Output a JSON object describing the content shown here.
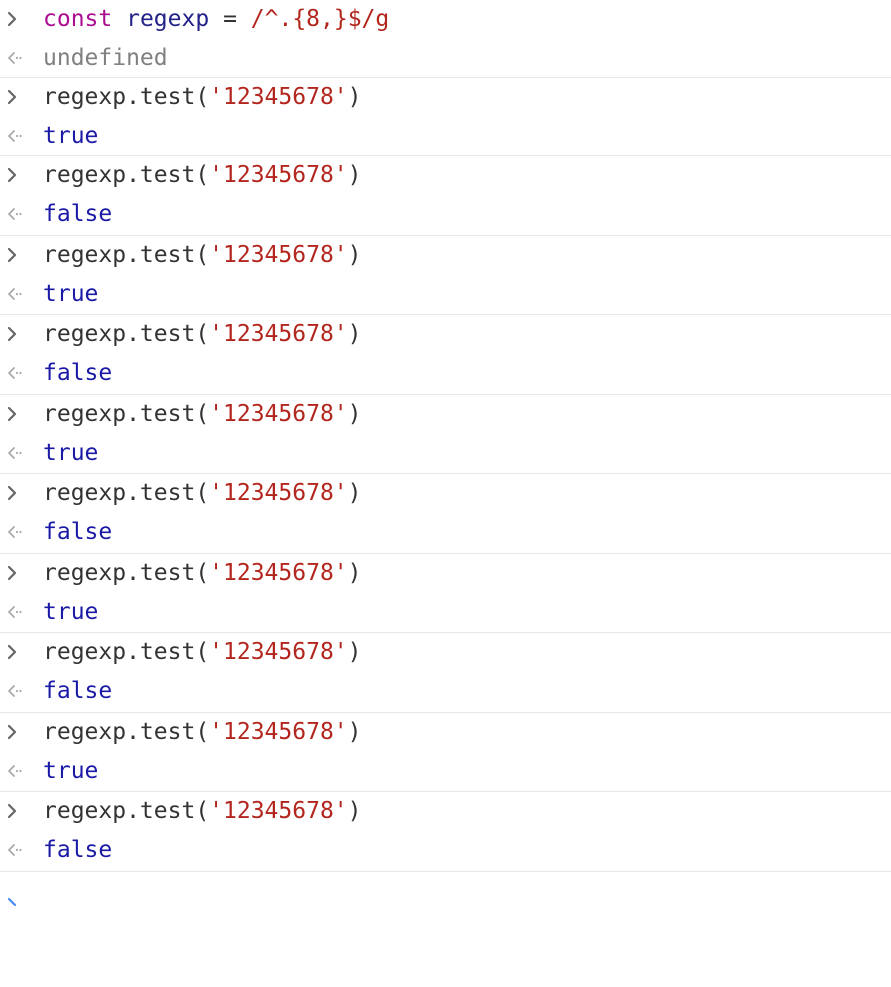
{
  "console": {
    "first": {
      "keyword": "const",
      "var_name": "regexp",
      "equals": "=",
      "regex": "/^.{8,}$/g",
      "result": "undefined"
    },
    "entries": [
      {
        "call_prefix": "regexp.test(",
        "arg": "'12345678'",
        "call_suffix": ")",
        "result": "true"
      },
      {
        "call_prefix": "regexp.test(",
        "arg": "'12345678'",
        "call_suffix": ")",
        "result": "false"
      },
      {
        "call_prefix": "regexp.test(",
        "arg": "'12345678'",
        "call_suffix": ")",
        "result": "true"
      },
      {
        "call_prefix": "regexp.test(",
        "arg": "'12345678'",
        "call_suffix": ")",
        "result": "false"
      },
      {
        "call_prefix": "regexp.test(",
        "arg": "'12345678'",
        "call_suffix": ")",
        "result": "true"
      },
      {
        "call_prefix": "regexp.test(",
        "arg": "'12345678'",
        "call_suffix": ")",
        "result": "false"
      },
      {
        "call_prefix": "regexp.test(",
        "arg": "'12345678'",
        "call_suffix": ")",
        "result": "true"
      },
      {
        "call_prefix": "regexp.test(",
        "arg": "'12345678'",
        "call_suffix": ")",
        "result": "false"
      },
      {
        "call_prefix": "regexp.test(",
        "arg": "'12345678'",
        "call_suffix": ")",
        "result": "true"
      },
      {
        "call_prefix": "regexp.test(",
        "arg": "'12345678'",
        "call_suffix": ")",
        "result": "false"
      }
    ]
  },
  "icons": {
    "input": "chevron-right-icon",
    "output": "return-arrow-icon",
    "prompt": "prompt-chevron-icon"
  },
  "colors": {
    "keyword": "#aa0d91",
    "variable": "#222288",
    "string": "#b3261e",
    "undefined": "#808080",
    "boolean": "#1a1aa6",
    "prompt": "#4a8af4"
  }
}
